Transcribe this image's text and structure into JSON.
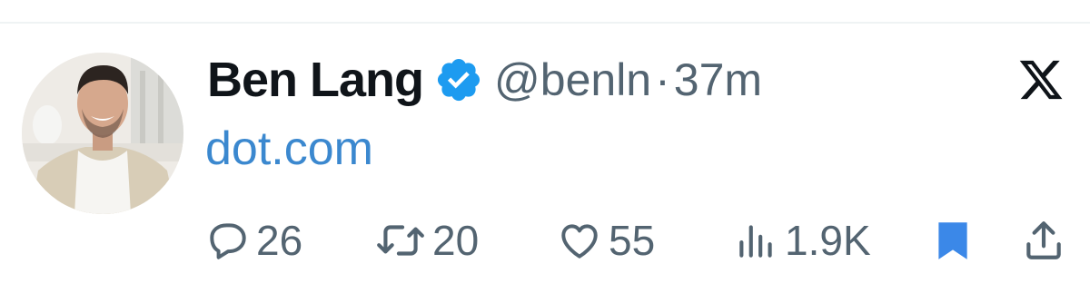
{
  "tweet": {
    "author": {
      "display_name": "Ben Lang",
      "handle": "@benln",
      "verified": true,
      "verified_color": "#1d9bf0"
    },
    "separator": "·",
    "timestamp": "37m",
    "text": "dot.com",
    "link_color": "#3b88cf",
    "brand_icon": "x-logo-icon"
  },
  "actions": {
    "reply": {
      "icon": "reply-icon",
      "count": "26"
    },
    "retweet": {
      "icon": "retweet-icon",
      "count": "20"
    },
    "like": {
      "icon": "heart-icon",
      "count": "55"
    },
    "views": {
      "icon": "views-icon",
      "count": "1.9K"
    },
    "bookmark": {
      "icon": "bookmark-icon",
      "active": true,
      "color": "#3b88e8"
    },
    "share": {
      "icon": "share-icon"
    }
  },
  "colors": {
    "secondary_text": "#536471",
    "primary_text": "#0f1419",
    "divider": "#eff3f4"
  }
}
